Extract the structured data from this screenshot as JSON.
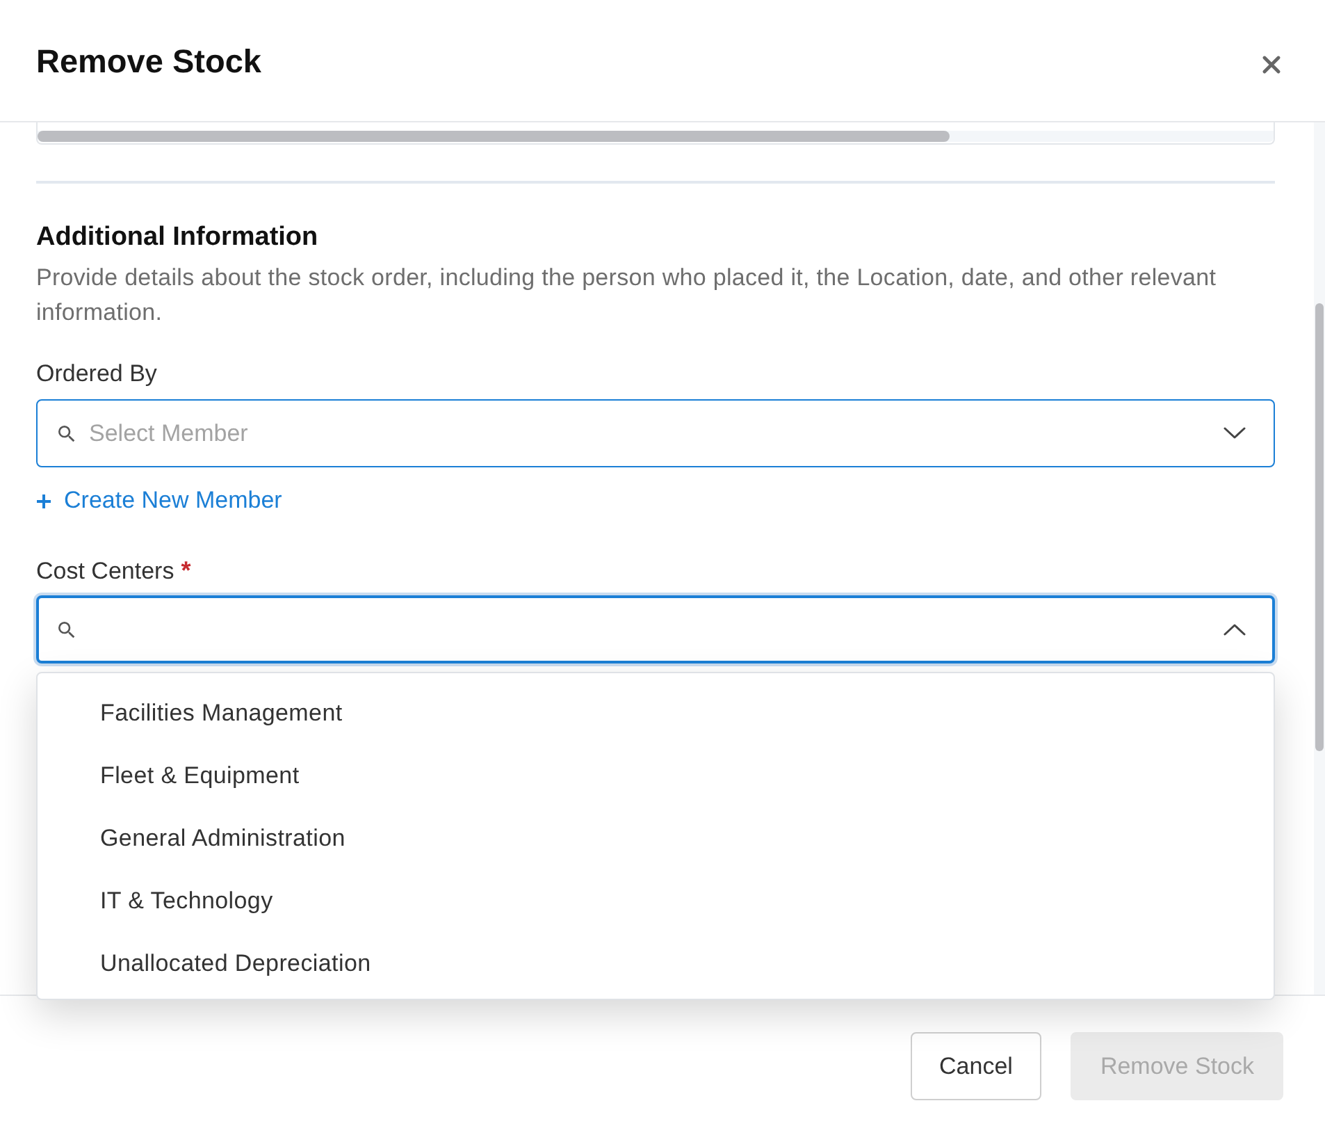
{
  "dialog": {
    "title": "Remove Stock"
  },
  "section": {
    "title": "Additional Information",
    "description": "Provide details about the stock order, including the person who placed it, the Location, date, and other relevant information."
  },
  "fields": [
    {
      "kind": "select",
      "label": "Ordered By",
      "placeholder": "Select Member",
      "focused": false,
      "expanded": false,
      "link": {
        "label": "Create New Member"
      }
    },
    {
      "kind": "select",
      "label": "Cost Centers",
      "required_mark": "*",
      "focused": true,
      "expanded": true,
      "options": [
        {
          "label": "Facilities Management",
          "selected": false
        },
        {
          "label": "Fleet & Equipment",
          "selected": false
        },
        {
          "label": "General Administration",
          "selected": false
        },
        {
          "label": "IT & Technology",
          "selected": false
        },
        {
          "label": "Unallocated Depreciation",
          "selected": false
        }
      ]
    }
  ],
  "footer": {
    "buttons": [
      {
        "kind": "secondary",
        "label": "Cancel",
        "disabled": false
      },
      {
        "kind": "primary",
        "label": "Remove Stock",
        "disabled": true
      }
    ]
  }
}
